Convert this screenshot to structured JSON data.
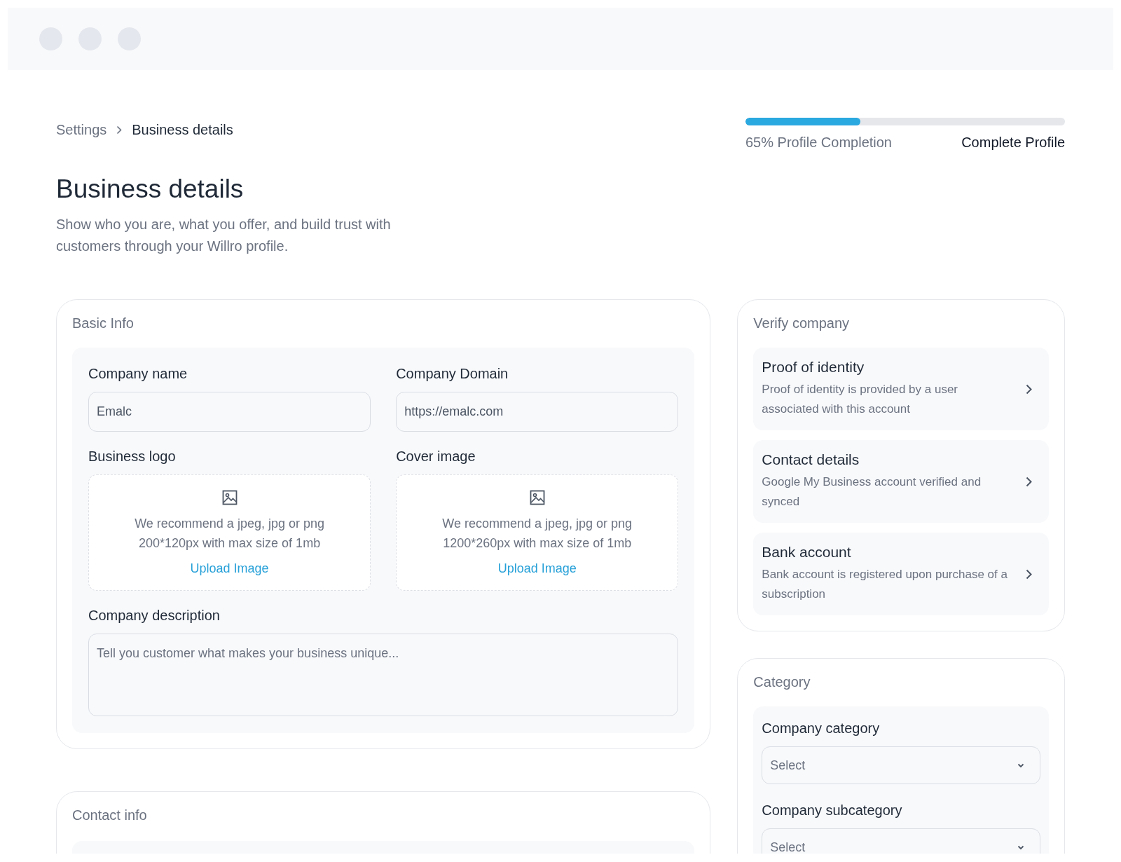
{
  "window": {
    "controls": [
      {
        "kind": "dot"
      },
      {
        "kind": "dot"
      },
      {
        "kind": "dot"
      }
    ]
  },
  "breadcrumb": [
    {
      "label": "Settings",
      "selected": false
    },
    {
      "label": "Business details",
      "selected": true
    }
  ],
  "profile": {
    "level": 0.36,
    "label": "65% Profile Completion",
    "action": "Complete Profile"
  },
  "page": {
    "title": "Business details",
    "subtitle": "Show who you are, what you offer, and build trust with customers through your Willro profile."
  },
  "basic_info": {
    "title": "Basic Info",
    "fields": [
      {
        "label": "Company name",
        "value": "Emalc"
      },
      {
        "label": "Company Domain",
        "value": "https://emalc.com"
      }
    ],
    "uploads": [
      {
        "label": "Business logo",
        "hint": "We recommend a jpeg, jpg or png 200*120px with max size of 1mb",
        "action": "Upload Image"
      },
      {
        "label": "Cover image",
        "hint": "We recommend a jpeg, jpg or png 1200*260px with max size of 1mb",
        "action": "Upload Image"
      }
    ],
    "description": {
      "label": "Company description",
      "placeholder": "Tell you customer what makes your business unique..."
    }
  },
  "verify": {
    "title": "Verify company",
    "items": [
      {
        "title": "Proof of identity",
        "text": "Proof of identity is provided by a user associated with this account"
      },
      {
        "title": "Contact details",
        "text": "Google My Business account verified and synced"
      },
      {
        "title": "Bank account",
        "text": "Bank account is registered upon purchase of a subscription"
      }
    ]
  },
  "category": {
    "title": "Category",
    "selects": [
      {
        "label": "Company category",
        "placeholder": "Select"
      },
      {
        "label": "Company subcategory",
        "placeholder": "Select"
      }
    ]
  },
  "contact_info": {
    "title": "Contact info"
  }
}
